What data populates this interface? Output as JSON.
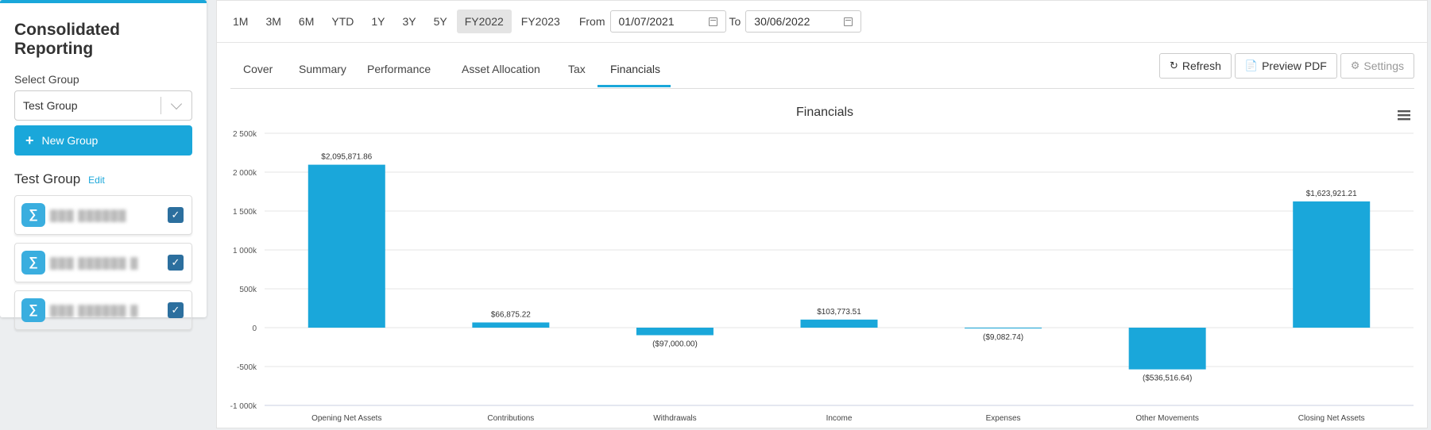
{
  "sidebar": {
    "title": "Consolidated Reporting",
    "select_label": "Select Group",
    "selected_group": "Test Group",
    "new_group_label": "New Group",
    "group_name": "Test Group",
    "edit_label": "Edit",
    "accounts": [
      {
        "name": "███ ██████",
        "checked": true
      },
      {
        "name": "███ ██████ █",
        "checked": true
      },
      {
        "name": "███ ██████ █",
        "checked": true
      }
    ]
  },
  "toolbar": {
    "periods": [
      "1M",
      "3M",
      "6M",
      "YTD",
      "1Y",
      "3Y",
      "5Y",
      "FY2022",
      "FY2023"
    ],
    "active_period": "FY2022",
    "from_label": "From",
    "from_date": "01/07/2021",
    "to_label": "To",
    "to_date": "30/06/2022"
  },
  "tabs": {
    "items": [
      "Cover",
      "Summary",
      "Performance",
      "Asset Allocation",
      "Tax",
      "Financials"
    ],
    "active": "Financials"
  },
  "actions": {
    "refresh": "Refresh",
    "preview_pdf": "Preview PDF",
    "settings": "Settings"
  },
  "colors": {
    "accent": "#1aa7da",
    "bar": "#1aa7da"
  },
  "chart_data": {
    "type": "bar",
    "title": "Financials",
    "categories": [
      "Opening Net Assets",
      "Contributions",
      "Withdrawals",
      "Income",
      "Expenses",
      "Other Movements",
      "Closing Net Assets"
    ],
    "values": [
      2095871.86,
      66875.22,
      -97000.0,
      103773.51,
      -9082.74,
      -536516.64,
      1623921.21
    ],
    "data_labels": [
      "$2,095,871.86",
      "$66,875.22",
      "($97,000.00)",
      "$103,773.51",
      "($9,082.74)",
      "($536,516.64)",
      "$1,623,921.21"
    ],
    "yticks": [
      "2 500k",
      "2 000k",
      "1 500k",
      "1 000k",
      "500k",
      "0",
      "-500k",
      "-1 000k"
    ],
    "ytick_values": [
      2500000,
      2000000,
      1500000,
      1000000,
      500000,
      0,
      -500000,
      -1000000
    ],
    "ylim": [
      -1000000,
      2500000
    ],
    "grid": true,
    "menu_icon": "hamburger-menu-icon"
  }
}
